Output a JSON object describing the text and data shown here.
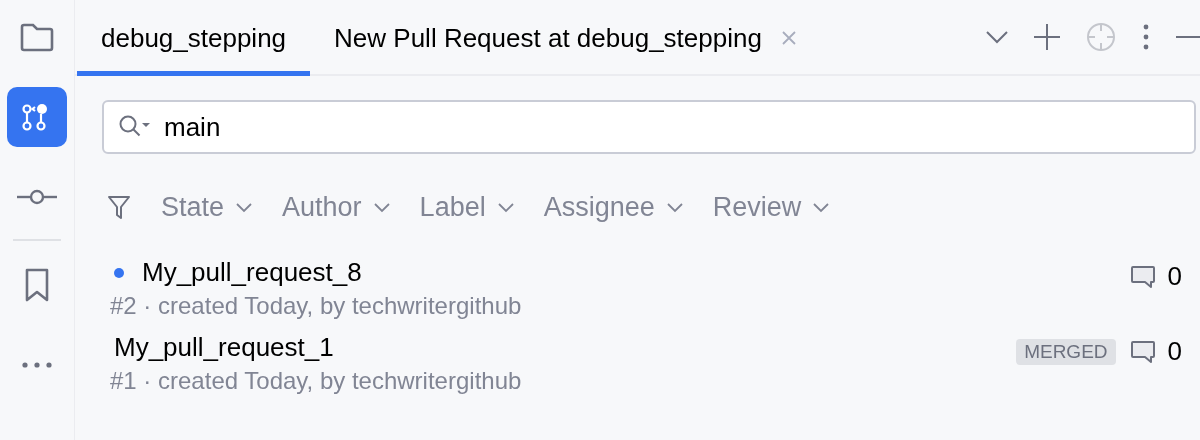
{
  "sidebar": {
    "items": [
      {
        "kind": "folder",
        "selected": false
      },
      {
        "kind": "pull-requests",
        "selected": true
      },
      {
        "kind": "commit",
        "selected": false
      },
      {
        "kind": "bookmark",
        "selected": false
      },
      {
        "kind": "more",
        "selected": false
      }
    ]
  },
  "tabs": [
    {
      "label": "debug_stepping",
      "selected": true,
      "closable": false
    },
    {
      "label": "New Pull Request at debug_stepping",
      "selected": false,
      "closable": true
    }
  ],
  "search": {
    "value": "main"
  },
  "filters": [
    {
      "label": "State"
    },
    {
      "label": "Author"
    },
    {
      "label": "Label"
    },
    {
      "label": "Assignee"
    },
    {
      "label": "Review"
    }
  ],
  "pull_requests": [
    {
      "title": "My_pull_request_8",
      "subtitle": "#2 · created Today, by techwritergithub",
      "unread": true,
      "comments": "0"
    },
    {
      "title": "My_pull_request_1",
      "subtitle": "#1 · created Today, by techwritergithub",
      "unread": false,
      "badge": "MERGED",
      "comments": "0"
    }
  ]
}
